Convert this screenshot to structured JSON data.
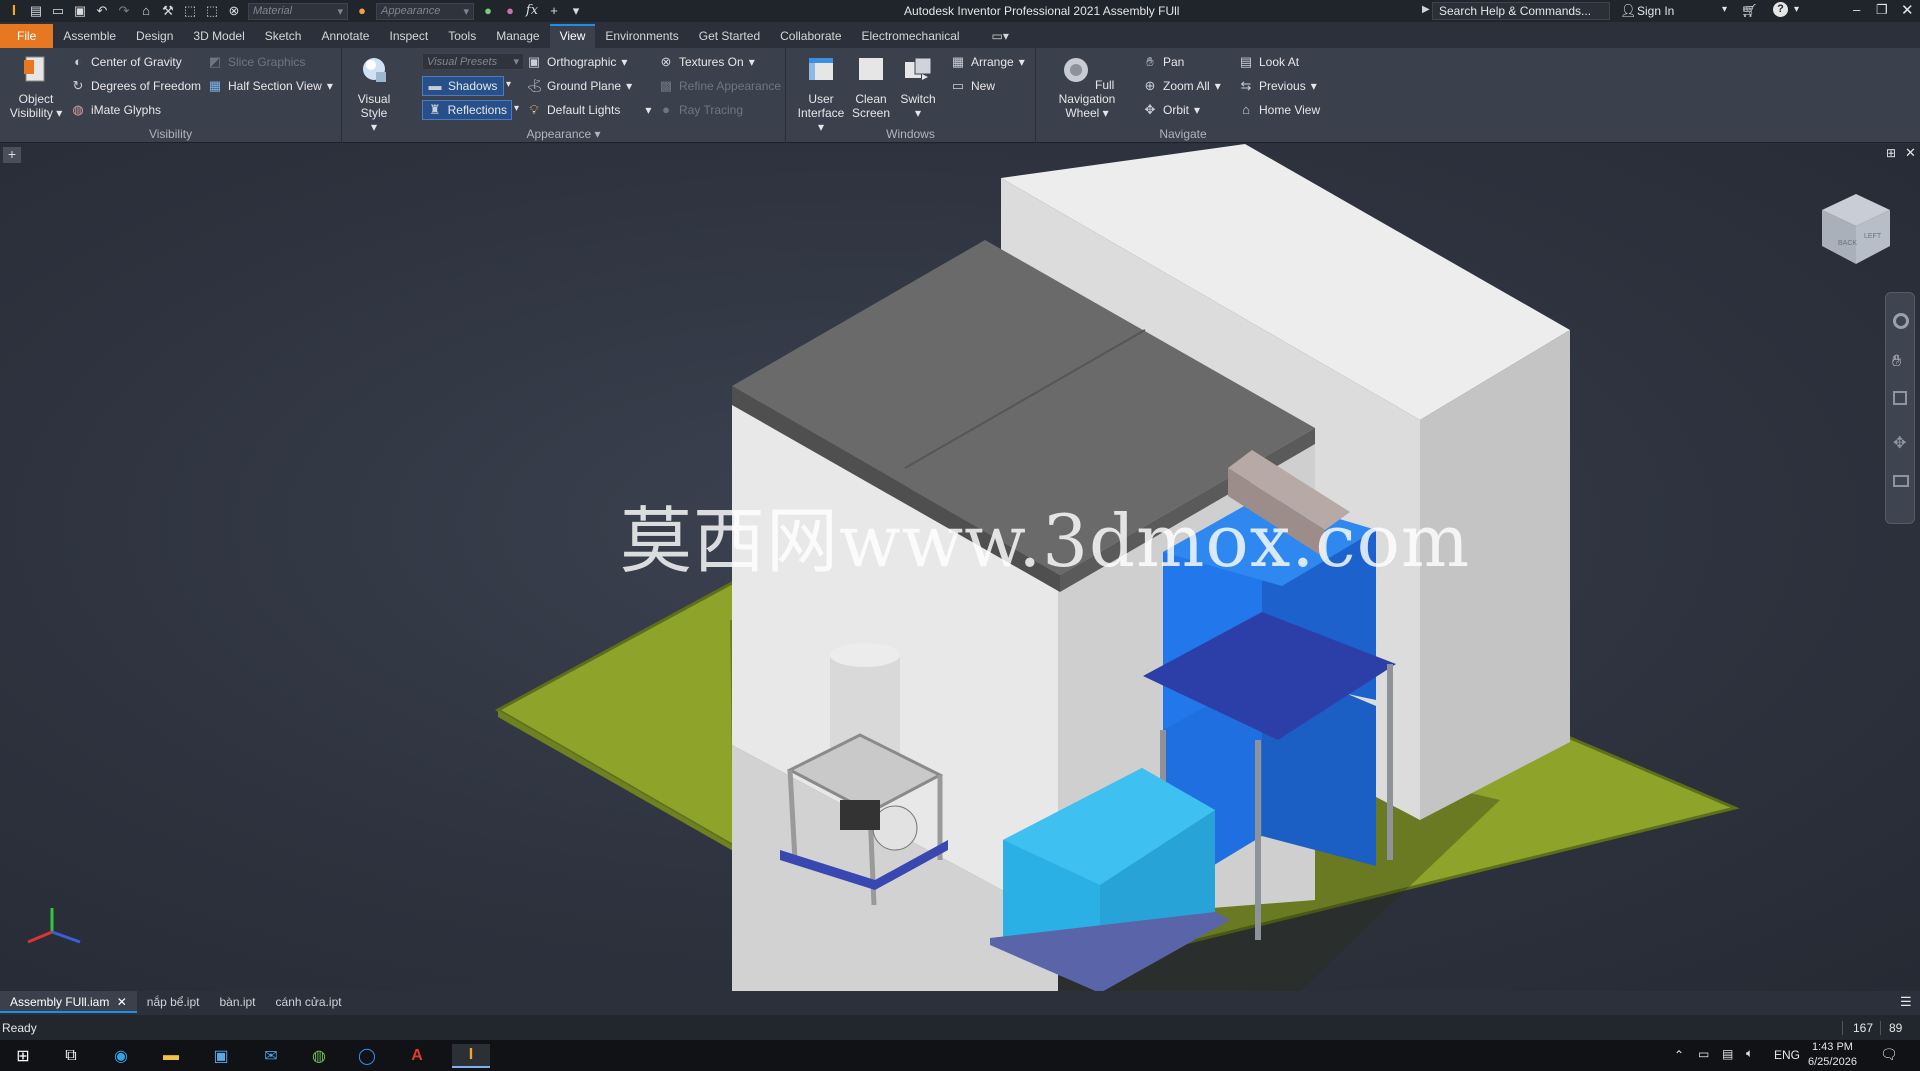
{
  "titlebar": {
    "app_title": "Autodesk Inventor Professional 2021    Assembly FUll",
    "material_placeholder": "Material",
    "appearance_placeholder": "Appearance",
    "search_placeholder": "Search Help & Commands...",
    "sign_in": "Sign In",
    "fx_label": "fx"
  },
  "tabs": [
    "File",
    "Assemble",
    "Design",
    "3D Model",
    "Sketch",
    "Annotate",
    "Inspect",
    "Tools",
    "Manage",
    "View",
    "Environments",
    "Get Started",
    "Collaborate",
    "Electromechanical"
  ],
  "active_tab": "View",
  "ribbon": {
    "visibility": {
      "label": "Visibility",
      "object_visibility": "Object Visibility",
      "center_of_gravity": "Center of Gravity",
      "degrees_of_freedom": "Degrees of Freedom",
      "imate_glyphs": "iMate Glyphs",
      "slice_graphics": "Slice Graphics",
      "half_section_view": "Half Section View"
    },
    "appearance": {
      "label": "Appearance",
      "visual_style": "Visual Style",
      "visual_presets": "Visual Presets",
      "shadows": "Shadows",
      "reflections": "Reflections",
      "orthographic": "Orthographic",
      "ground_plane": "Ground Plane",
      "default_lights": "Default Lights",
      "textures_on": "Textures On",
      "refine_appearance": "Refine Appearance",
      "ray_tracing": "Ray Tracing"
    },
    "windows": {
      "label": "Windows",
      "user_interface": "User Interface",
      "clean_screen": "Clean Screen",
      "switch": "Switch",
      "arrange": "Arrange",
      "new": "New"
    },
    "navigate": {
      "label": "Navigate",
      "full_navigation_wheel": "Full Navigation Wheel",
      "pan": "Pan",
      "zoom_all": "Zoom All",
      "orbit": "Orbit",
      "look_at": "Look At",
      "previous": "Previous",
      "home_view": "Home View"
    }
  },
  "viewport": {
    "watermark": "莫西网www.3dmox.com",
    "viewcube_labels": [
      "BACK",
      "LEFT"
    ]
  },
  "doc_tabs": [
    "Assembly FUll.iam",
    "nắp bể.ipt",
    "bàn.ipt",
    "cánh cửa.ipt"
  ],
  "active_doc": "Assembly FUll.iam",
  "status": {
    "text": "Ready",
    "count1": "167",
    "count2": "89"
  },
  "taskbar": {
    "lang": "ENG",
    "time": "1:43 PM",
    "date": "6/25/2026"
  },
  "colors": {
    "file_tab": "#e87722",
    "accent": "#1f8fe3",
    "ground": "#8ea32a",
    "blue_unit": "#1f6fe0",
    "cyan_unit": "#27a3d8"
  }
}
